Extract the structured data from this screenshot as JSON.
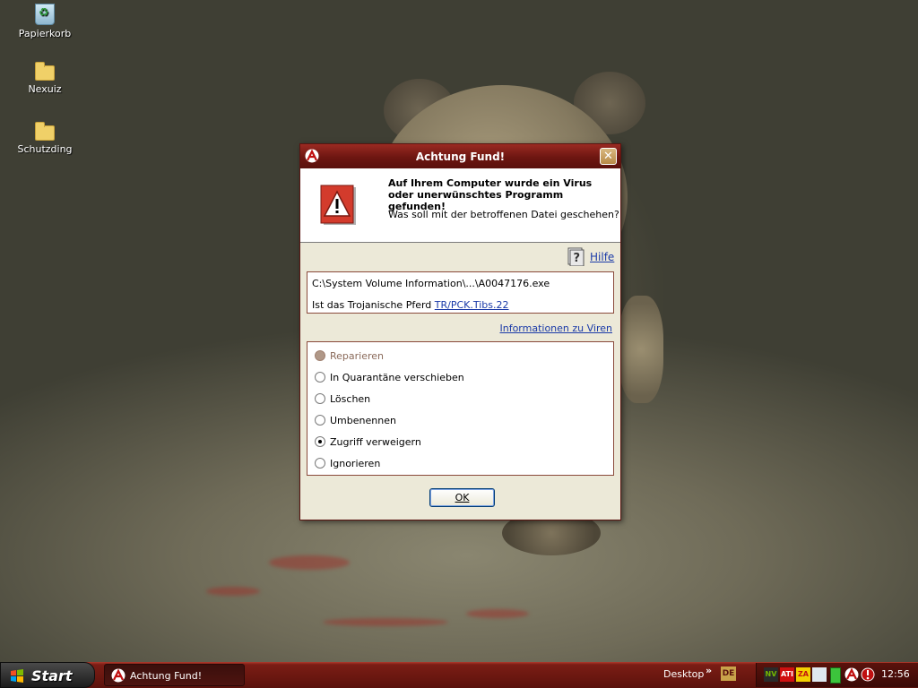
{
  "desktop": {
    "icons": [
      {
        "label": "Papierkorb",
        "icon": "recycle-bin-icon"
      },
      {
        "label": "Nexuiz",
        "icon": "folder-icon"
      },
      {
        "label": "Schutzding",
        "icon": "folder-icon"
      }
    ]
  },
  "dialog": {
    "title": "Achtung Fund!",
    "close_glyph": "✕",
    "headline": "Auf Ihrem Computer wurde ein Virus oder unerwünschtes Programm gefunden!",
    "question": "Was soll mit der betroffenen Datei geschehen?",
    "help_label": "Hilfe",
    "file_path": "C:\\System Volume Information\\...\\A0047176.exe",
    "threat_prefix": "Ist das Trojanische Pferd",
    "threat_name": "TR/PCK.Tibs.22",
    "virus_info_link": "Informationen zu Viren",
    "options": [
      {
        "label": "Reparieren",
        "state": "disabled"
      },
      {
        "label": "In Quarantäne verschieben",
        "state": "unchecked"
      },
      {
        "label": "Löschen",
        "state": "unchecked"
      },
      {
        "label": "Umbenennen",
        "state": "unchecked"
      },
      {
        "label": "Zugriff verweigern",
        "state": "checked"
      },
      {
        "label": "Ignorieren",
        "state": "unchecked"
      }
    ],
    "ok_label": "OK"
  },
  "taskbar": {
    "start_label": "Start",
    "task_button_label": "Achtung Fund!",
    "desktop_toolbar_label": "Desktop",
    "toolbar_chevron": "»",
    "language": "DE",
    "tray_icons": [
      {
        "name": "nvidia-icon",
        "text": "NV"
      },
      {
        "name": "ati-icon",
        "text": "ATI"
      },
      {
        "name": "zonealarm-icon",
        "text": "ZA"
      },
      {
        "name": "network-icon",
        "text": ""
      },
      {
        "name": "battery-icon",
        "text": ""
      },
      {
        "name": "avira-tray-icon",
        "text": ""
      },
      {
        "name": "avira-guard-icon",
        "text": ""
      }
    ],
    "clock": "12:56"
  },
  "colors": {
    "title_bar": "#6d1611",
    "link": "#1a3aa8",
    "taskbar": "#6a1710"
  }
}
